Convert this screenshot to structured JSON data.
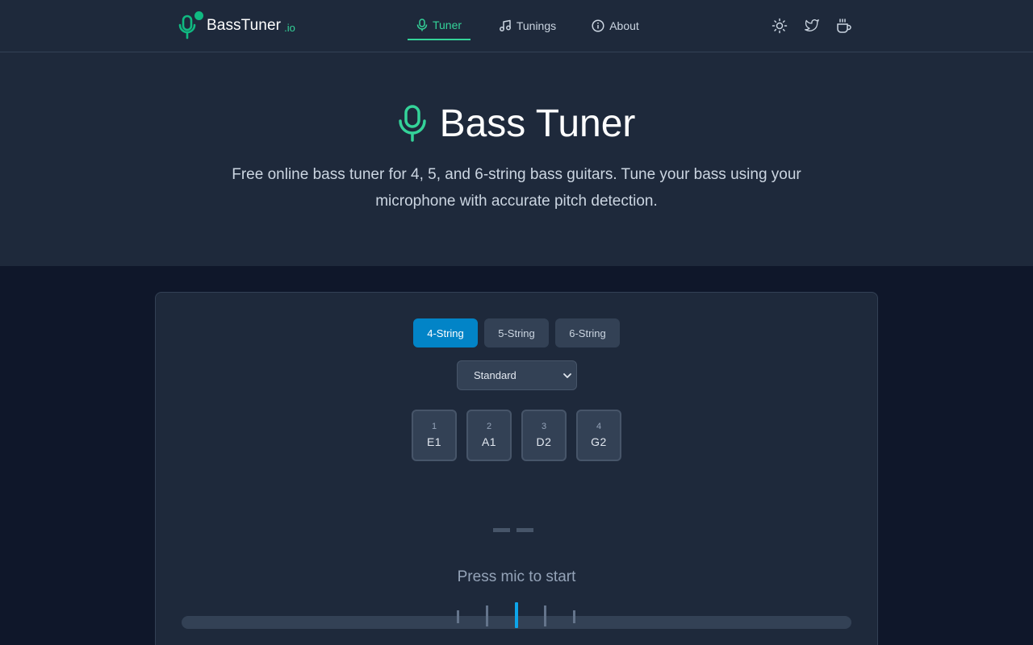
{
  "nav": {
    "logo_text": "BassTuner",
    "logo_tld": ".io",
    "tabs": [
      {
        "label": "Tuner",
        "icon": "mic-icon",
        "active": true
      },
      {
        "label": "Tunings",
        "icon": "music-note-icon",
        "active": false
      },
      {
        "label": "About",
        "icon": "info-icon",
        "active": false
      }
    ],
    "actions": [
      "sun-icon",
      "twitter-icon",
      "coffee-cup-icon"
    ]
  },
  "hero": {
    "title": "Bass Tuner",
    "subtitle": "Free online bass tuner for 4, 5, and 6-string bass guitars. Tune your bass using your microphone with accurate pitch detection."
  },
  "tuner": {
    "string_count_options": [
      "4-String",
      "5-String",
      "6-String"
    ],
    "selected_string_count": "4-String",
    "tuning_selected": "Standard",
    "strings": [
      {
        "num": "1",
        "note": "E1"
      },
      {
        "num": "2",
        "note": "A1"
      },
      {
        "num": "3",
        "note": "D2"
      },
      {
        "num": "4",
        "note": "G2"
      }
    ],
    "status": "Press mic to start"
  },
  "colors": {
    "accent_green": "#34d399",
    "accent_blue": "#0284c7",
    "needle": "#0ea5e9",
    "bg_dark": "#0f172a",
    "panel": "#1e293b"
  }
}
